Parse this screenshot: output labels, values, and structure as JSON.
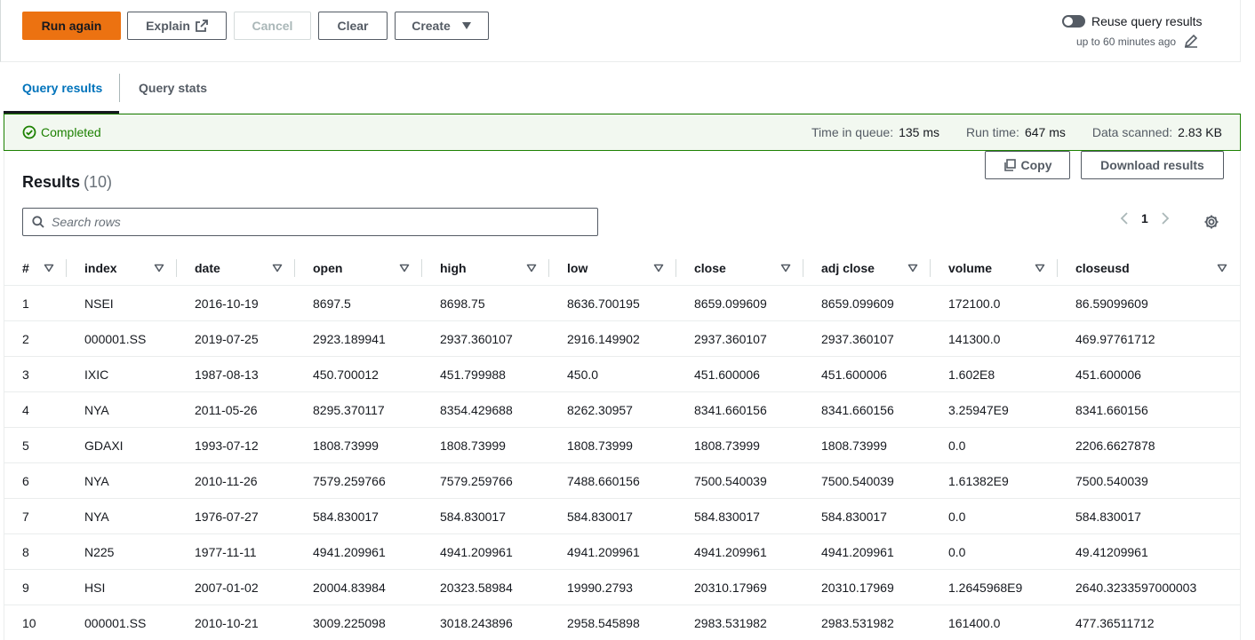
{
  "toolbar": {
    "run_again": "Run again",
    "explain": "Explain",
    "cancel": "Cancel",
    "clear": "Clear",
    "create": "Create",
    "reuse_label": "Reuse query results",
    "reuse_sub": "up to 60 minutes ago",
    "reuse_enabled": false
  },
  "tabs": [
    {
      "label": "Query results",
      "active": true
    },
    {
      "label": "Query stats",
      "active": false
    }
  ],
  "status": {
    "state": "Completed",
    "queue_label": "Time in queue:",
    "queue_value": "135 ms",
    "runtime_label": "Run time:",
    "runtime_value": "647 ms",
    "scanned_label": "Data scanned:",
    "scanned_value": "2.83 KB"
  },
  "results": {
    "title": "Results",
    "count": "(10)",
    "copy": "Copy",
    "download": "Download results",
    "search_placeholder": "Search rows",
    "page": "1"
  },
  "table": {
    "columns": [
      "#",
      "index",
      "date",
      "open",
      "high",
      "low",
      "close",
      "adj close",
      "volume",
      "closeusd"
    ],
    "rows": [
      [
        "1",
        "NSEI",
        "2016-10-19",
        "8697.5",
        "8698.75",
        "8636.700195",
        "8659.099609",
        "8659.099609",
        "172100.0",
        "86.59099609"
      ],
      [
        "2",
        "000001.SS",
        "2019-07-25",
        "2923.189941",
        "2937.360107",
        "2916.149902",
        "2937.360107",
        "2937.360107",
        "141300.0",
        "469.97761712"
      ],
      [
        "3",
        "IXIC",
        "1987-08-13",
        "450.700012",
        "451.799988",
        "450.0",
        "451.600006",
        "451.600006",
        "1.602E8",
        "451.600006"
      ],
      [
        "4",
        "NYA",
        "2011-05-26",
        "8295.370117",
        "8354.429688",
        "8262.30957",
        "8341.660156",
        "8341.660156",
        "3.25947E9",
        "8341.660156"
      ],
      [
        "5",
        "GDAXI",
        "1993-07-12",
        "1808.73999",
        "1808.73999",
        "1808.73999",
        "1808.73999",
        "1808.73999",
        "0.0",
        "2206.6627878"
      ],
      [
        "6",
        "NYA",
        "2010-11-26",
        "7579.259766",
        "7579.259766",
        "7488.660156",
        "7500.540039",
        "7500.540039",
        "1.61382E9",
        "7500.540039"
      ],
      [
        "7",
        "NYA",
        "1976-07-27",
        "584.830017",
        "584.830017",
        "584.830017",
        "584.830017",
        "584.830017",
        "0.0",
        "584.830017"
      ],
      [
        "8",
        "N225",
        "1977-11-11",
        "4941.209961",
        "4941.209961",
        "4941.209961",
        "4941.209961",
        "4941.209961",
        "0.0",
        "49.41209961"
      ],
      [
        "9",
        "HSI",
        "2007-01-02",
        "20004.83984",
        "20323.58984",
        "19990.2793",
        "20310.17969",
        "20310.17969",
        "1.2645968E9",
        "2640.3233597000003"
      ],
      [
        "10",
        "000001.SS",
        "2010-10-21",
        "3009.225098",
        "3018.243896",
        "2958.545898",
        "2983.531982",
        "2983.531982",
        "161400.0",
        "477.36511712"
      ]
    ]
  },
  "colors": {
    "primary": "#ec7211",
    "success": "#1d8102",
    "link": "#0073bb"
  }
}
